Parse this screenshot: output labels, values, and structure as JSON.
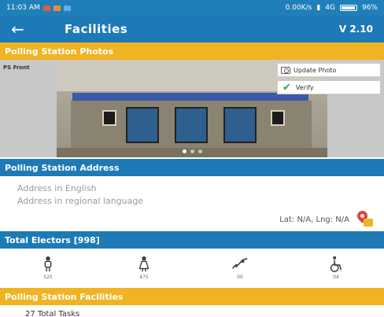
{
  "status_bar": {
    "time": "11:03 AM",
    "speed": "0.00K/s",
    "network": "4G",
    "battery": "96%"
  },
  "app_bar": {
    "back_icon": "back-arrow-icon",
    "title": "Facilities",
    "version": "V 2.10"
  },
  "photos_section": {
    "header": "Polling Station Photos",
    "caption": "PS Front",
    "update_label": "Update Photo",
    "verify_label": "Verify",
    "slide_count": 3,
    "active_slide": 1
  },
  "address_section": {
    "header": "Polling Station Address",
    "english": "Address in English",
    "regional": "Address in regional language",
    "latlng": "Lat: N/A, Lng: N/A"
  },
  "electors_section": {
    "header": "Total Electors [998]",
    "items": [
      {
        "icon": "male-icon",
        "count": "525"
      },
      {
        "icon": "female-icon",
        "count": "475"
      },
      {
        "icon": "third-gender-icon",
        "count": "00"
      },
      {
        "icon": "wheelchair-icon",
        "count": "04"
      }
    ]
  },
  "facilities_section": {
    "header": "Polling Station Facilities",
    "total_tasks": "27 Total Tasks"
  },
  "colors": {
    "primary": "#1d7ab6",
    "accent": "#f0b322",
    "verify": "#2ea84a",
    "pin": "#e0453a"
  }
}
